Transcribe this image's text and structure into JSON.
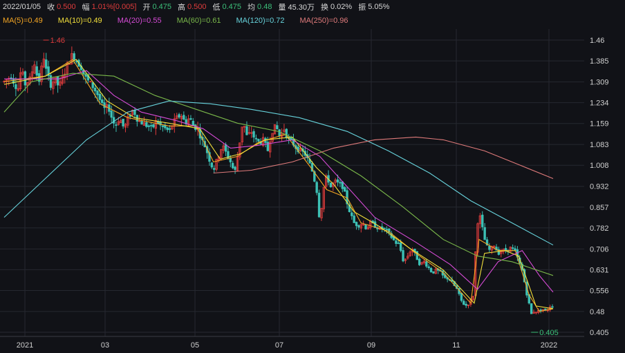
{
  "header": {
    "date": "2022/01/05",
    "close_label": "收",
    "close": "0.500",
    "range_label": "幅",
    "range": "1.01%[0.005]",
    "open_label": "开",
    "open": "0.475",
    "high_label": "高",
    "high": "0.500",
    "low_label": "低",
    "low": "0.475",
    "avg_label": "均",
    "avg": "0.48",
    "volume_label": "量",
    "volume": "45.30万",
    "turnover_label": "换",
    "turnover": "0.02%",
    "amplitude_label": "振",
    "amplitude": "5.05%"
  },
  "ma_legend": [
    {
      "text": "MA(5)=0.49",
      "color": "#f5a623"
    },
    {
      "text": "MA(10)=0.49",
      "color": "#f3e03b"
    },
    {
      "text": "MA(20)=0.55",
      "color": "#d64bd6"
    },
    {
      "text": "MA(60)=0.61",
      "color": "#7ab84a"
    },
    {
      "text": "MA(120)=0.72",
      "color": "#67d3dc"
    },
    {
      "text": "MA(250)=0.96",
      "color": "#e07b7b"
    }
  ],
  "colors": {
    "up": "#e03c3c",
    "down": "#3cc0b4",
    "grid": "#262830",
    "max_marker": "#e03c3c",
    "min_marker": "#3cc07a",
    "value_up": "#e03c3c",
    "value_down": "#3cc07a"
  },
  "chart_data": {
    "type": "candlestick",
    "yticks": [
      "1.46",
      "1.385",
      "1.309",
      "1.234",
      "1.159",
      "1.083",
      "1.008",
      "0.932",
      "0.857",
      "0.782",
      "0.706",
      "0.631",
      "0.556",
      "0.48",
      "0.405"
    ],
    "ylim": [
      0.39,
      1.5
    ],
    "xticks": [
      "2021",
      "03",
      "05",
      "07",
      "09",
      "11",
      "2022"
    ],
    "max_label": "1.46",
    "min_label": "0.405",
    "price_path": [
      [
        0,
        1.31
      ],
      [
        10,
        1.33
      ],
      [
        20,
        1.28
      ],
      [
        25,
        1.36
      ],
      [
        30,
        1.3
      ],
      [
        38,
        1.32
      ],
      [
        44,
        1.38
      ],
      [
        48,
        1.33
      ],
      [
        52,
        1.31
      ],
      [
        57,
        1.41
      ],
      [
        62,
        1.34
      ],
      [
        68,
        1.3
      ],
      [
        74,
        1.32
      ],
      [
        80,
        1.29
      ],
      [
        86,
        1.33
      ],
      [
        92,
        1.37
      ],
      [
        100,
        1.41
      ],
      [
        107,
        1.38
      ],
      [
        113,
        1.36
      ],
      [
        117,
        1.33
      ],
      [
        123,
        1.31
      ],
      [
        130,
        1.29
      ],
      [
        137,
        1.26
      ],
      [
        145,
        1.21
      ],
      [
        152,
        1.22
      ],
      [
        158,
        1.17
      ],
      [
        162,
        1.15
      ],
      [
        168,
        1.18
      ],
      [
        175,
        1.14
      ],
      [
        181,
        1.18
      ],
      [
        188,
        1.21
      ],
      [
        195,
        1.17
      ],
      [
        202,
        1.16
      ],
      [
        209,
        1.15
      ],
      [
        216,
        1.14
      ],
      [
        222,
        1.17
      ],
      [
        228,
        1.15
      ],
      [
        235,
        1.14
      ],
      [
        241,
        1.13
      ],
      [
        246,
        1.16
      ],
      [
        252,
        1.18
      ],
      [
        258,
        1.19
      ],
      [
        264,
        1.16
      ],
      [
        270,
        1.18
      ],
      [
        276,
        1.15
      ],
      [
        282,
        1.14
      ],
      [
        288,
        1.1
      ],
      [
        294,
        1.07
      ],
      [
        299,
        1.03
      ],
      [
        305,
        0.99
      ],
      [
        312,
        1.04
      ],
      [
        318,
        1.08
      ],
      [
        324,
        1.05
      ],
      [
        330,
        1.02
      ],
      [
        336,
        0.98
      ],
      [
        342,
        1.07
      ],
      [
        348,
        1.17
      ],
      [
        354,
        1.11
      ],
      [
        360,
        1.13
      ],
      [
        366,
        1.1
      ],
      [
        372,
        1.09
      ],
      [
        378,
        1.1
      ],
      [
        384,
        1.06
      ],
      [
        390,
        1.13
      ],
      [
        396,
        1.15
      ],
      [
        402,
        1.11
      ],
      [
        408,
        1.14
      ],
      [
        414,
        1.1
      ],
      [
        420,
        1.09
      ],
      [
        426,
        1.07
      ],
      [
        432,
        1.06
      ],
      [
        438,
        1.05
      ],
      [
        444,
        1.02
      ],
      [
        450,
        0.98
      ],
      [
        456,
        0.91
      ],
      [
        460,
        0.8
      ],
      [
        465,
        0.92
      ],
      [
        470,
        0.97
      ],
      [
        476,
        0.93
      ],
      [
        482,
        0.95
      ],
      [
        488,
        0.94
      ],
      [
        494,
        0.93
      ],
      [
        500,
        0.87
      ],
      [
        505,
        0.83
      ],
      [
        510,
        0.8
      ],
      [
        516,
        0.79
      ],
      [
        522,
        0.8
      ],
      [
        528,
        0.78
      ],
      [
        534,
        0.8
      ],
      [
        540,
        0.79
      ],
      [
        546,
        0.78
      ],
      [
        552,
        0.78
      ],
      [
        558,
        0.77
      ],
      [
        564,
        0.75
      ],
      [
        570,
        0.73
      ],
      [
        576,
        0.72
      ],
      [
        582,
        0.66
      ],
      [
        588,
        0.68
      ],
      [
        594,
        0.71
      ],
      [
        600,
        0.68
      ],
      [
        606,
        0.65
      ],
      [
        612,
        0.66
      ],
      [
        618,
        0.64
      ],
      [
        624,
        0.62
      ],
      [
        630,
        0.63
      ],
      [
        636,
        0.62
      ],
      [
        642,
        0.6
      ],
      [
        648,
        0.6
      ],
      [
        654,
        0.58
      ],
      [
        660,
        0.56
      ],
      [
        666,
        0.52
      ],
      [
        672,
        0.5
      ],
      [
        678,
        0.51
      ],
      [
        684,
        0.54
      ],
      [
        688,
        0.76
      ],
      [
        692,
        0.84
      ],
      [
        697,
        0.78
      ],
      [
        702,
        0.72
      ],
      [
        708,
        0.7
      ],
      [
        714,
        0.72
      ],
      [
        720,
        0.69
      ],
      [
        726,
        0.7
      ],
      [
        732,
        0.7
      ],
      [
        738,
        0.71
      ],
      [
        744,
        0.7
      ],
      [
        750,
        0.66
      ],
      [
        756,
        0.62
      ],
      [
        760,
        0.56
      ],
      [
        764,
        0.52
      ],
      [
        768,
        0.47
      ],
      [
        772,
        0.48
      ],
      [
        778,
        0.48
      ],
      [
        784,
        0.49
      ],
      [
        790,
        0.48
      ],
      [
        796,
        0.5
      ],
      [
        800,
        0.5
      ]
    ],
    "ma_series": [
      {
        "name": "MA(5)",
        "color": "#f5a623",
        "points": [
          [
            0,
            1.31
          ],
          [
            60,
            1.33
          ],
          [
            100,
            1.39
          ],
          [
            140,
            1.23
          ],
          [
            180,
            1.18
          ],
          [
            240,
            1.15
          ],
          [
            280,
            1.15
          ],
          [
            305,
            1.02
          ],
          [
            340,
            1.04
          ],
          [
            370,
            1.09
          ],
          [
            410,
            1.12
          ],
          [
            450,
            0.99
          ],
          [
            470,
            0.92
          ],
          [
            500,
            0.89
          ],
          [
            520,
            0.8
          ],
          [
            560,
            0.77
          ],
          [
            600,
            0.69
          ],
          [
            640,
            0.62
          ],
          [
            680,
            0.51
          ],
          [
            692,
            0.74
          ],
          [
            720,
            0.7
          ],
          [
            745,
            0.7
          ],
          [
            765,
            0.54
          ],
          [
            780,
            0.48
          ],
          [
            800,
            0.49
          ]
        ]
      },
      {
        "name": "MA(10)",
        "color": "#f3e03b",
        "points": [
          [
            0,
            1.3
          ],
          [
            60,
            1.33
          ],
          [
            105,
            1.39
          ],
          [
            150,
            1.24
          ],
          [
            190,
            1.18
          ],
          [
            240,
            1.16
          ],
          [
            285,
            1.14
          ],
          [
            315,
            1.03
          ],
          [
            345,
            1.05
          ],
          [
            380,
            1.1
          ],
          [
            420,
            1.11
          ],
          [
            455,
            1.0
          ],
          [
            480,
            0.94
          ],
          [
            510,
            0.84
          ],
          [
            545,
            0.79
          ],
          [
            590,
            0.71
          ],
          [
            640,
            0.63
          ],
          [
            685,
            0.51
          ],
          [
            700,
            0.69
          ],
          [
            730,
            0.7
          ],
          [
            750,
            0.68
          ],
          [
            775,
            0.5
          ],
          [
            800,
            0.49
          ]
        ]
      },
      {
        "name": "MA(20)",
        "color": "#d64bd6",
        "points": [
          [
            0,
            1.32
          ],
          [
            80,
            1.32
          ],
          [
            120,
            1.35
          ],
          [
            160,
            1.26
          ],
          [
            200,
            1.2
          ],
          [
            250,
            1.17
          ],
          [
            290,
            1.14
          ],
          [
            330,
            1.07
          ],
          [
            370,
            1.08
          ],
          [
            420,
            1.1
          ],
          [
            460,
            1.04
          ],
          [
            500,
            0.93
          ],
          [
            540,
            0.82
          ],
          [
            600,
            0.73
          ],
          [
            650,
            0.65
          ],
          [
            690,
            0.56
          ],
          [
            720,
            0.66
          ],
          [
            755,
            0.7
          ],
          [
            780,
            0.61
          ],
          [
            800,
            0.55
          ]
        ]
      },
      {
        "name": "MA(60)",
        "color": "#7ab84a",
        "points": [
          [
            0,
            1.2
          ],
          [
            40,
            1.31
          ],
          [
            100,
            1.34
          ],
          [
            160,
            1.33
          ],
          [
            220,
            1.26
          ],
          [
            280,
            1.21
          ],
          [
            340,
            1.16
          ],
          [
            400,
            1.13
          ],
          [
            460,
            1.06
          ],
          [
            520,
            0.97
          ],
          [
            580,
            0.86
          ],
          [
            640,
            0.74
          ],
          [
            690,
            0.68
          ],
          [
            740,
            0.66
          ],
          [
            800,
            0.61
          ]
        ]
      },
      {
        "name": "MA(120)",
        "color": "#67d3dc",
        "points": [
          [
            0,
            0.82
          ],
          [
            60,
            0.96
          ],
          [
            120,
            1.1
          ],
          [
            180,
            1.2
          ],
          [
            240,
            1.24
          ],
          [
            300,
            1.23
          ],
          [
            360,
            1.21
          ],
          [
            430,
            1.18
          ],
          [
            500,
            1.13
          ],
          [
            560,
            1.06
          ],
          [
            620,
            0.98
          ],
          [
            680,
            0.88
          ],
          [
            740,
            0.8
          ],
          [
            800,
            0.72
          ]
        ]
      },
      {
        "name": "MA(250)",
        "color": "#e07b7b",
        "points": [
          [
            305,
            0.98
          ],
          [
            360,
            0.99
          ],
          [
            420,
            1.02
          ],
          [
            480,
            1.07
          ],
          [
            540,
            1.1
          ],
          [
            600,
            1.11
          ],
          [
            640,
            1.1
          ],
          [
            700,
            1.06
          ],
          [
            750,
            1.01
          ],
          [
            800,
            0.96
          ]
        ]
      }
    ],
    "max_point": {
      "x": 57,
      "value": 1.46
    },
    "min_point": {
      "x": 768,
      "value": 0.405
    }
  }
}
